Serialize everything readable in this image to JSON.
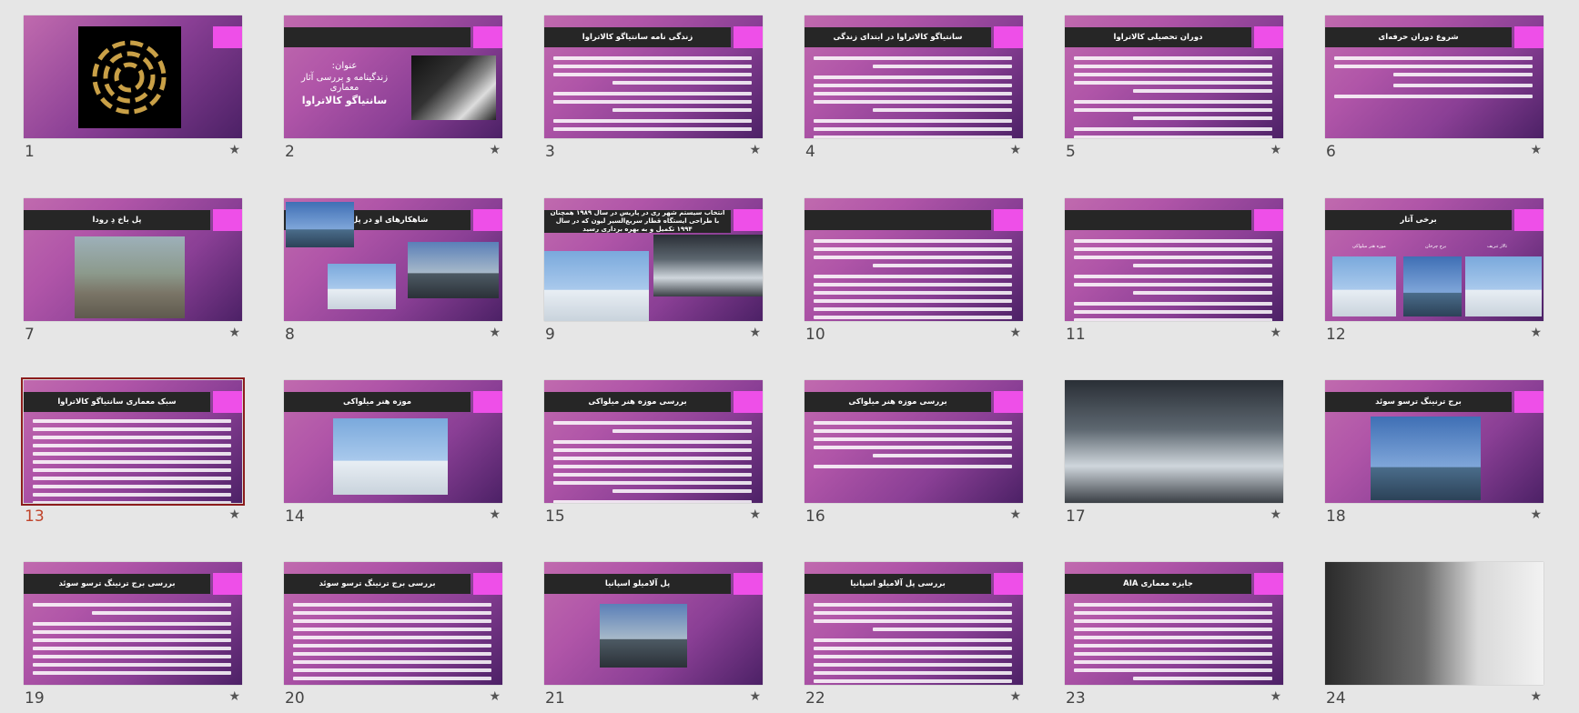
{
  "slides": [
    {
      "number": "1",
      "title": ""
    },
    {
      "number": "2",
      "title": "",
      "subtitle_label": "عنوان:",
      "subtitle_line2": "زندگینامه و بررسی آثار معماری",
      "subtitle_name": "سانتیاگو کالاتراوا"
    },
    {
      "number": "3",
      "title": "زندگی نامه سانتیاگو کالاتراوا"
    },
    {
      "number": "4",
      "title": "سانتیاگو کالاتراوا در ابتدای زندگی"
    },
    {
      "number": "5",
      "title": "دوران تحصیلی کالاتراوا"
    },
    {
      "number": "6",
      "title": "شروع دوران حرفه‌ای"
    },
    {
      "number": "7",
      "title": "پل باخ دِ رودا"
    },
    {
      "number": "8",
      "title": "شاهکارهای او در پل سازی"
    },
    {
      "number": "9",
      "title": "انتخاب سیستم شهر ری در پاریس در سال ۱۹۸۹ همچنان با طراحی ایستگاه قطار سریع‌السیر لیون که در سال ۱۹۹۴ تکمیل و به بهره برداری رسید"
    },
    {
      "number": "10",
      "title": ""
    },
    {
      "number": "11",
      "title": ""
    },
    {
      "number": "12",
      "title": "برخی آثار",
      "captions": [
        "تالار تنریف",
        "برج چرخان",
        "موزه هنر میلواکی"
      ]
    },
    {
      "number": "13",
      "title": "سبک معماری سانتیاگو کالاتراوا"
    },
    {
      "number": "14",
      "title": "موزه هنر میلواکی"
    },
    {
      "number": "15",
      "title": "بررسی موزه هنر میلواکی"
    },
    {
      "number": "16",
      "title": "بررسی موزه هنر میلواکی"
    },
    {
      "number": "17",
      "title": ""
    },
    {
      "number": "18",
      "title": "برج ترنینگ ترسو سوئد"
    },
    {
      "number": "19",
      "title": "بررسی برج ترنینگ ترسو سوئد"
    },
    {
      "number": "20",
      "title": "بررسی برج ترنینگ ترسو سوئد"
    },
    {
      "number": "21",
      "title": "پل آلامیلو اسپانیا"
    },
    {
      "number": "22",
      "title": "بررسی پل آلامیلو اسپانیا"
    },
    {
      "number": "23",
      "title": "جایزه معماری AIA"
    },
    {
      "number": "24",
      "title": ""
    }
  ],
  "selected_slide": "13",
  "star_glyph": "★",
  "colors": {
    "accent": "#ee4fe8",
    "title_bar": "#262626",
    "selection": "#8c1c1c",
    "selected_number": "#c0442b"
  }
}
